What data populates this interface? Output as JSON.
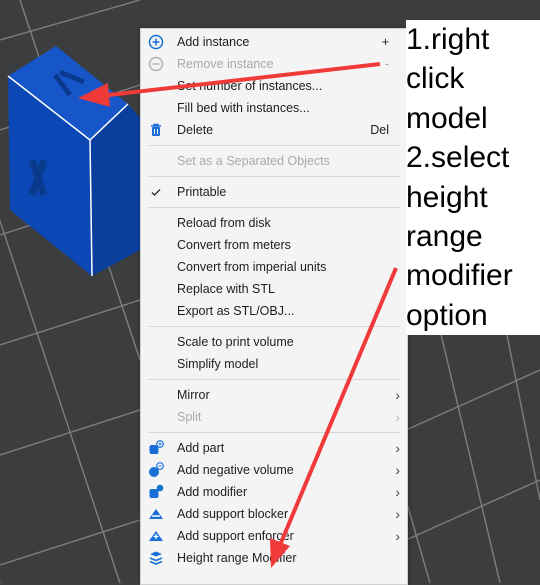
{
  "menu": {
    "items": [
      {
        "label": "Add instance",
        "shortcut": "+",
        "icon": "plus-circle-icon",
        "disabled": false,
        "submenu": false
      },
      {
        "label": "Remove instance",
        "shortcut": "-",
        "icon": "minus-circle-icon",
        "disabled": true,
        "submenu": false
      },
      {
        "label": "Set number of instances...",
        "shortcut": "",
        "disabled": false,
        "submenu": false
      },
      {
        "label": "Fill bed with instances...",
        "shortcut": "",
        "disabled": false,
        "submenu": false
      },
      {
        "label": "Delete",
        "shortcut": "Del",
        "icon": "trash-icon",
        "disabled": false,
        "submenu": false
      },
      {
        "label": "Set as a Separated Objects",
        "shortcut": "",
        "disabled": true,
        "submenu": false
      },
      {
        "label": "Printable",
        "shortcut": "",
        "icon": "check-icon",
        "disabled": false,
        "submenu": false
      },
      {
        "label": "Reload from disk",
        "shortcut": "",
        "disabled": false,
        "submenu": false
      },
      {
        "label": "Convert from meters",
        "shortcut": "",
        "disabled": false,
        "submenu": false
      },
      {
        "label": "Convert from imperial units",
        "shortcut": "",
        "disabled": false,
        "submenu": false
      },
      {
        "label": "Replace with STL",
        "shortcut": "",
        "disabled": false,
        "submenu": false
      },
      {
        "label": "Export as STL/OBJ...",
        "shortcut": "",
        "disabled": false,
        "submenu": false
      },
      {
        "label": "Scale to print volume",
        "shortcut": "",
        "disabled": false,
        "submenu": false
      },
      {
        "label": "Simplify model",
        "shortcut": "",
        "disabled": false,
        "submenu": false
      },
      {
        "label": "Mirror",
        "shortcut": "",
        "disabled": false,
        "submenu": true
      },
      {
        "label": "Split",
        "shortcut": "",
        "disabled": true,
        "submenu": true
      },
      {
        "label": "Add part",
        "shortcut": "",
        "icon": "add-part-icon",
        "disabled": false,
        "submenu": true
      },
      {
        "label": "Add negative volume",
        "shortcut": "",
        "icon": "add-negative-volume-icon",
        "disabled": false,
        "submenu": true
      },
      {
        "label": "Add modifier",
        "shortcut": "",
        "icon": "add-modifier-icon",
        "disabled": false,
        "submenu": true
      },
      {
        "label": "Add support blocker",
        "shortcut": "",
        "icon": "support-blocker-icon",
        "disabled": false,
        "submenu": true
      },
      {
        "label": "Add support enforcer",
        "shortcut": "",
        "icon": "support-enforcer-icon",
        "disabled": false,
        "submenu": true
      },
      {
        "label": "Height range Modifier",
        "shortcut": "",
        "icon": "height-range-icon",
        "disabled": false,
        "submenu": false
      }
    ]
  },
  "annotation": {
    "lines": [
      "1.right",
      "click",
      "model",
      "2.select",
      "height",
      "range",
      "modifier",
      "option"
    ]
  },
  "colors": {
    "accent": "#1a6fd6",
    "model_blue": "#0a4ab8",
    "arrow_red": "#f03a3a"
  }
}
